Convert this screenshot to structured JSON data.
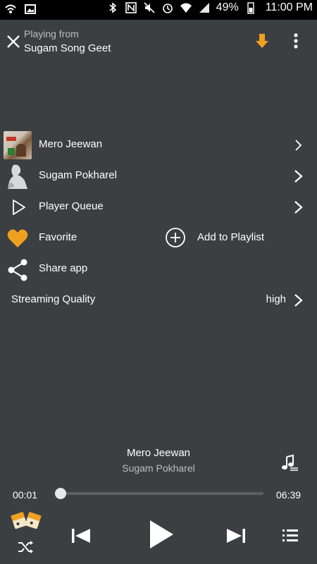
{
  "status_bar": {
    "battery_percent": "49%",
    "time": "11:00 PM"
  },
  "header": {
    "playing_from_label": "Playing from",
    "source_name": "Sugam Song Geet",
    "accent_color": "#f0a020"
  },
  "menu": {
    "album": "Mero Jeewan",
    "artist": "Sugam Pokharel",
    "queue": "Player Queue",
    "favorite": "Favorite",
    "add_to_playlist": "Add to Playlist",
    "share": "Share app",
    "streaming_quality_label": "Streaming Quality",
    "streaming_quality_value": "high"
  },
  "now_playing": {
    "title": "Mero Jeewan",
    "artist": "Sugam Pokharel",
    "current_time": "00:01",
    "total_time": "06:39",
    "progress_fraction": 0.003
  }
}
